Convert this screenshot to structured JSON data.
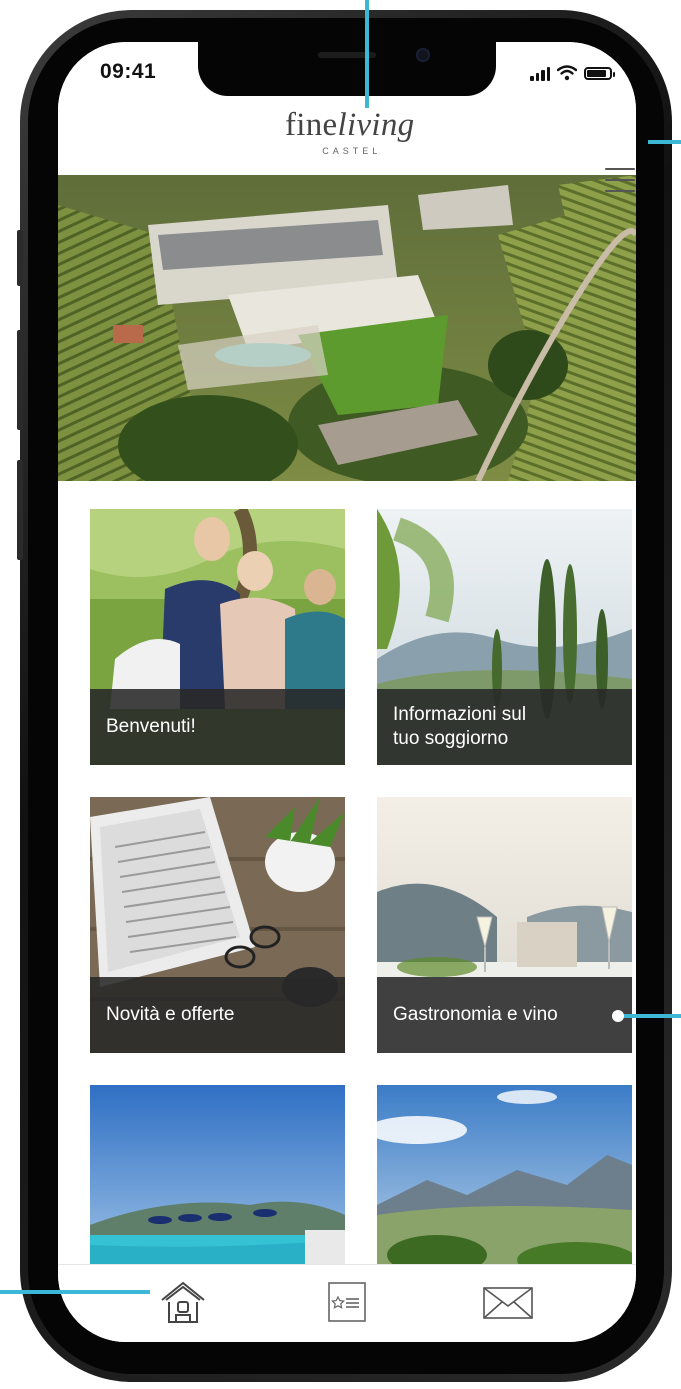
{
  "status_bar": {
    "time": "09:41",
    "icons": [
      "signal-icon",
      "wifi-icon",
      "battery-icon"
    ]
  },
  "header": {
    "logo_main": "fine",
    "logo_italic": "living",
    "logo_sub": "CASTEL",
    "menu_icon": "hamburger-icon"
  },
  "tiles": [
    {
      "label": "Benvenuti!"
    },
    {
      "label_line1": "Informazioni sul",
      "label_line2": "tuo soggiorno"
    },
    {
      "label": "Novità e offerte"
    },
    {
      "label": "Gastronomia e vino"
    },
    {
      "label": ""
    },
    {
      "label": ""
    }
  ],
  "tab_bar": {
    "icons": [
      "home-icon",
      "favorites-list-icon",
      "mail-icon"
    ]
  },
  "colors": {
    "callout": "#3cb8d6",
    "tile_label_bg": "#282828",
    "text_dark": "#111111"
  }
}
